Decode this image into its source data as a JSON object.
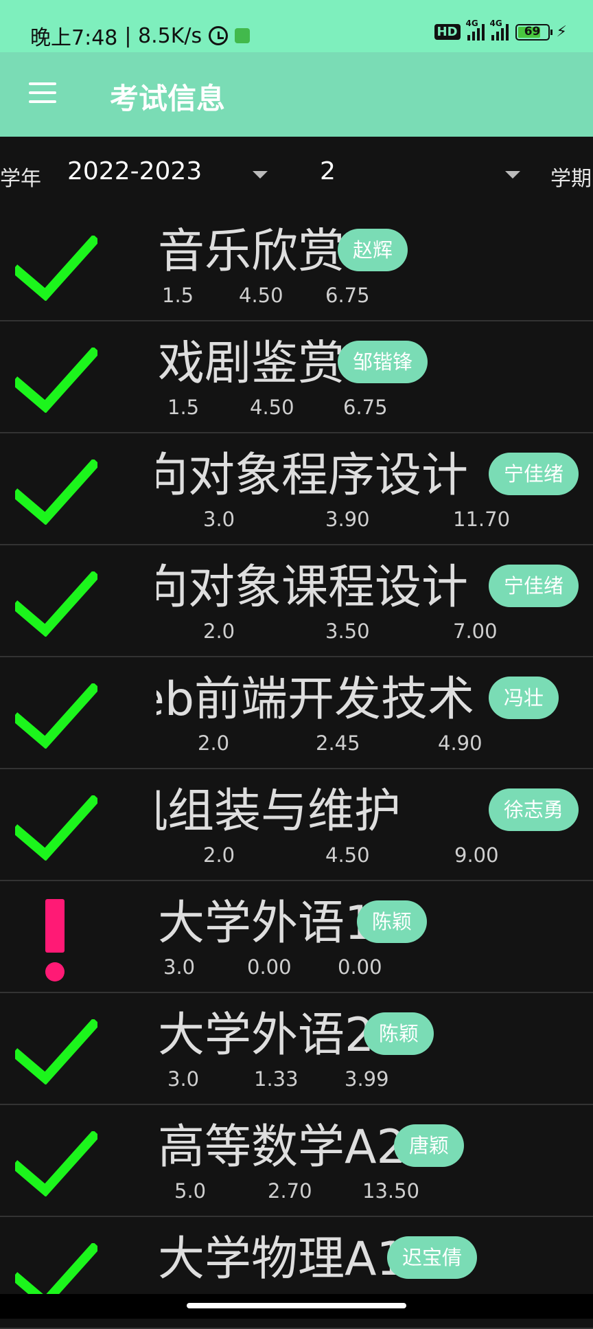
{
  "status_bar": {
    "time": "晚上7:48",
    "speed": "| 8.5K/s",
    "hd": "HD",
    "network1": "4G",
    "network2": "4G",
    "battery": "69",
    "icons": [
      "alarm-icon",
      "app-notification-icon",
      "signal-icon",
      "battery-icon",
      "charging-icon"
    ]
  },
  "app_bar": {
    "title": "考试信息",
    "menu_icon": "menu-icon"
  },
  "filters": {
    "year_label": "学年",
    "year_value": "2022-2023",
    "term_value": "2",
    "term_label": "学期"
  },
  "courses": [
    {
      "name": "音乐欣赏",
      "teacher": "赵辉",
      "credit": "1.5",
      "grade_point": "4.50",
      "score": "6.75",
      "status": "passed"
    },
    {
      "name": "戏剧鉴赏",
      "teacher": "邹锴锋",
      "credit": "1.5",
      "grade_point": "4.50",
      "score": "6.75",
      "status": "passed"
    },
    {
      "name": "向对象程序设计",
      "teacher": "宁佳绪",
      "credit": "3.0",
      "grade_point": "3.90",
      "score": "11.70",
      "status": "passed"
    },
    {
      "name": "向对象课程设计",
      "teacher": "宁佳绪",
      "credit": "2.0",
      "grade_point": "3.50",
      "score": "7.00",
      "status": "passed"
    },
    {
      "name": "eb前端开发技术",
      "teacher": "冯壮",
      "credit": "2.0",
      "grade_point": "2.45",
      "score": "4.90",
      "status": "passed"
    },
    {
      "name": "机组装与维护",
      "teacher": "徐志勇",
      "credit": "2.0",
      "grade_point": "4.50",
      "score": "9.00",
      "status": "passed"
    },
    {
      "name": "大学外语1",
      "teacher": "陈颖",
      "credit": "3.0",
      "grade_point": "0.00",
      "score": "0.00",
      "status": "failed"
    },
    {
      "name": "大学外语2",
      "teacher": "陈颖",
      "credit": "3.0",
      "grade_point": "1.33",
      "score": "3.99",
      "status": "passed"
    },
    {
      "name": "高等数学A2",
      "teacher": "唐颖",
      "credit": "5.0",
      "grade_point": "2.70",
      "score": "13.50",
      "status": "passed"
    },
    {
      "name": "大学物理A1",
      "teacher": "迟宝倩",
      "credit": "",
      "grade_point": "",
      "score": "",
      "status": "passed"
    }
  ],
  "colors": {
    "accent": "#7adcb5",
    "status_bar": "#7eefbd",
    "check": "#1cf51c",
    "warning": "#ff1a75",
    "background": "#131313"
  }
}
